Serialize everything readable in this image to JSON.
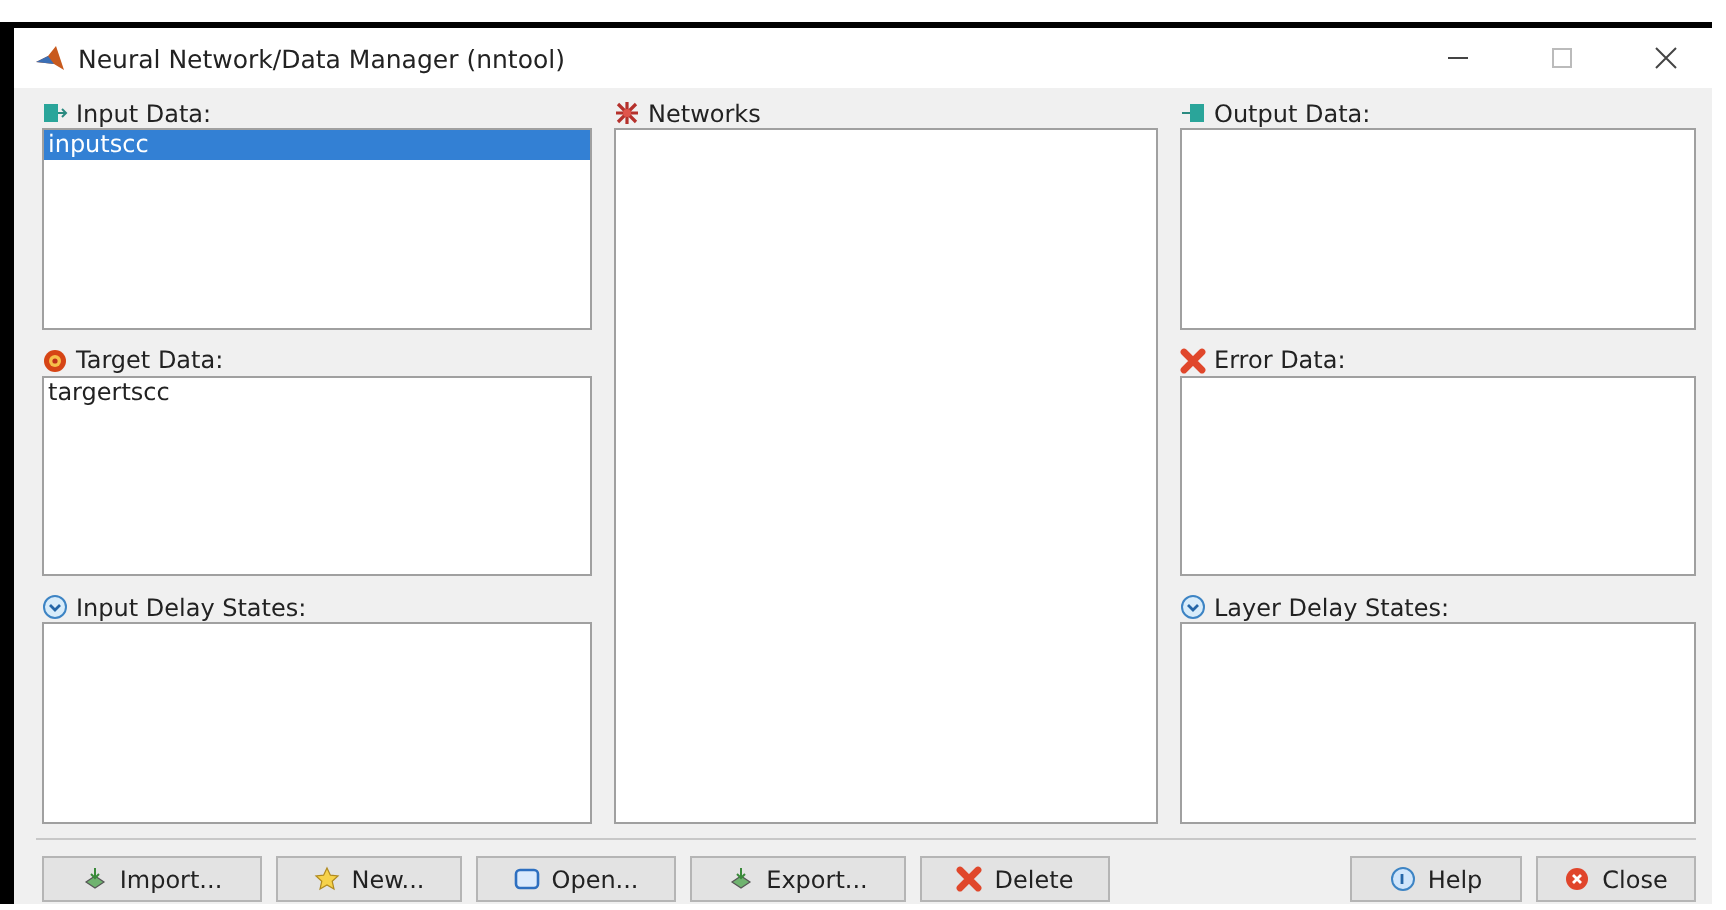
{
  "window": {
    "title": "Neural Network/Data Manager (nntool)"
  },
  "columns": [
    [
      {
        "kind": "input",
        "label": "Input Data:",
        "items": [
          {
            "text": "inputscc",
            "selected": true
          }
        ]
      },
      {
        "kind": "target",
        "label": "Target Data:",
        "items": [
          {
            "text": "targertscc",
            "selected": false
          }
        ]
      },
      {
        "kind": "delay",
        "label": "Input Delay States:"
      }
    ],
    [
      {
        "kind": "network",
        "label": "Networks"
      }
    ],
    [
      {
        "kind": "output",
        "label": "Output Data:"
      },
      {
        "kind": "error",
        "label": "Error Data:"
      },
      {
        "kind": "delay",
        "label": "Layer Delay States:"
      }
    ]
  ],
  "buttons_left": [
    {
      "kind": "import",
      "label": "Import..."
    },
    {
      "kind": "new",
      "label": "New..."
    },
    {
      "kind": "open",
      "label": "Open..."
    },
    {
      "kind": "export",
      "label": "Export..."
    },
    {
      "kind": "delete",
      "label": "Delete"
    }
  ],
  "buttons_right": [
    {
      "kind": "help",
      "label": "Help"
    },
    {
      "kind": "close",
      "label": "Close"
    }
  ]
}
